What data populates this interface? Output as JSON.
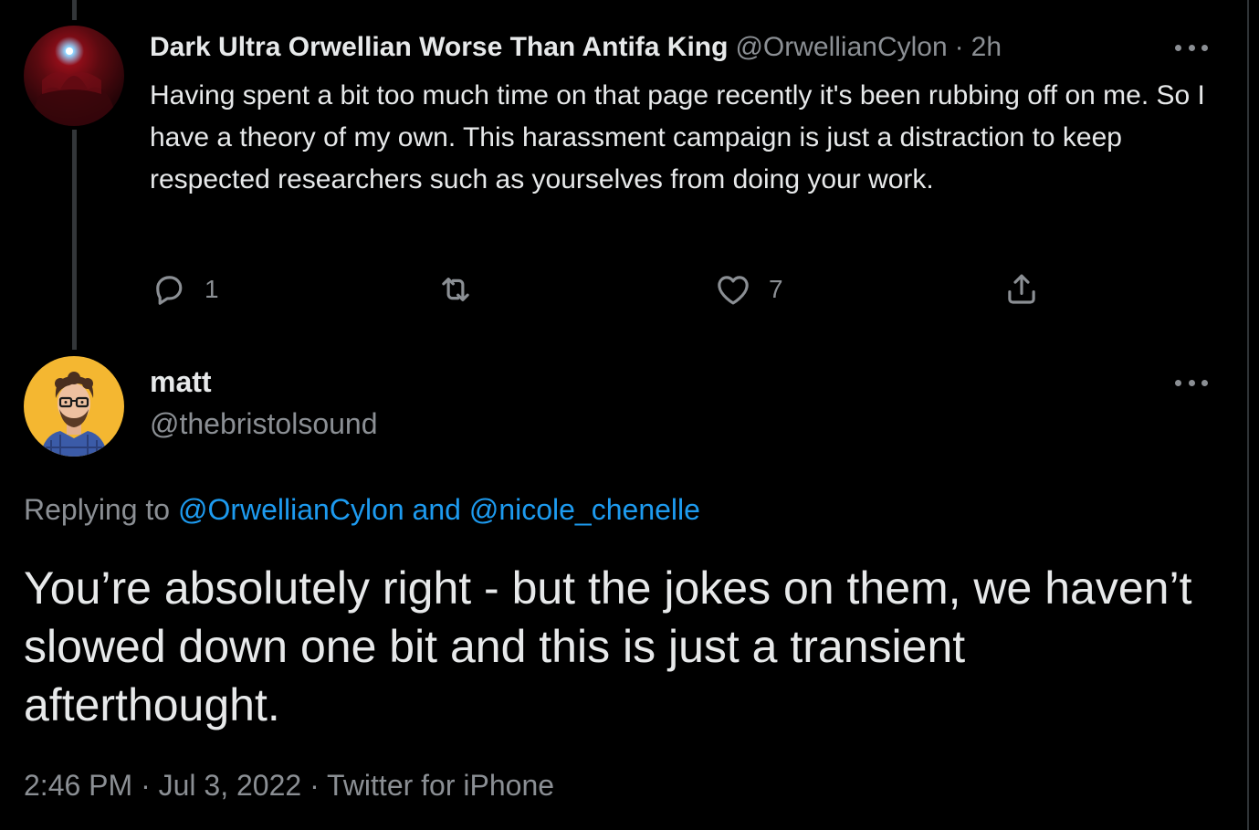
{
  "parent_tweet": {
    "display_name": "Dark Ultra Orwellian Worse Than Antifa King",
    "handle": "@OrwellianCylon",
    "separator": "·",
    "time": "2h",
    "text": "Having spent a bit too much time on that page recently it's been rubbing off on me. So I have a theory of my own. This harassment campaign is just a distraction to keep respected researchers such as yourselves from doing your work.",
    "actions": {
      "reply_icon": "reply-icon",
      "reply_count": "1",
      "retweet_icon": "retweet-icon",
      "like_icon": "heart-icon",
      "like_count": "7",
      "share_icon": "share-icon"
    },
    "more_icon": "more-horizontal-icon"
  },
  "main_tweet": {
    "display_name": "matt",
    "handle": "@thebristolsound",
    "more_icon": "more-horizontal-icon",
    "replying_prefix": "Replying to",
    "replying_user_1": "@OrwellianCylon",
    "replying_and": "and",
    "replying_user_2": "@nicole_chenelle",
    "text": "You’re absolutely right - but the jokes on them, we haven’t slowed down one bit and this is just a transient afterthought.",
    "time": "2:46 PM",
    "separator_1": "·",
    "date": "Jul 3, 2022",
    "separator_2": "·",
    "source": "Twitter for iPhone"
  },
  "colors": {
    "background": "#000000",
    "text": "#e7e9ea",
    "secondary": "#8b8f94",
    "link": "#1d9bf0",
    "thread_line": "#333639"
  }
}
